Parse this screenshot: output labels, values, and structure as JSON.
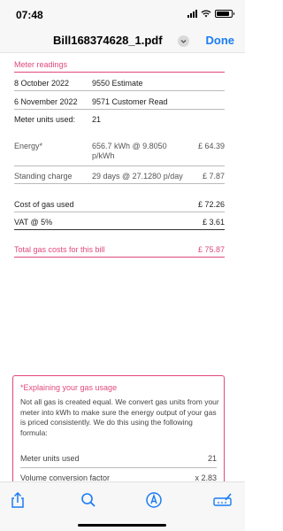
{
  "status_bar": {
    "time": "07:48",
    "battery_level": 0.9
  },
  "nav": {
    "title": "Bill168374628_1.pdf",
    "done_label": "Done"
  },
  "meter": {
    "heading": "Meter readings",
    "rows": [
      {
        "date": "8 October 2022",
        "reading": "9550 Estimate"
      },
      {
        "date": "6 November 2022",
        "reading": "9571 Customer Read"
      }
    ],
    "units_label": "Meter units used:",
    "units_value": "21"
  },
  "charges": {
    "energy": {
      "label": "Energy*",
      "detail_line1": "656.7 kWh @ 9.8050",
      "detail_line2": "p/kWh",
      "amount": "£ 64.39"
    },
    "standing": {
      "label": "Standing charge",
      "detail": "29 days @ 27.1280 p/day",
      "amount": "£ 7.87"
    }
  },
  "totals": {
    "cost_label": "Cost of gas used",
    "cost_value": "£ 72.26",
    "vat_label": "VAT @ 5%",
    "vat_value": "£ 3.61",
    "total_label": "Total gas costs for this bill",
    "total_value": "£ 75.87"
  },
  "explain": {
    "title": "*Explaining your gas usage",
    "paragraph": "Not all gas is created equal. We convert gas units from your meter into kWh to make sure the energy output of your gas is priced consistently. We do this using the following formula:",
    "rows": [
      {
        "label": "Meter units used",
        "value": "21"
      },
      {
        "label": "Volume conversion factor",
        "value": "x 2.83"
      }
    ]
  },
  "toolbar": {
    "icons": [
      "share-icon",
      "search-icon",
      "markup-icon",
      "signature-icon"
    ],
    "accent": "#1a7cf5"
  },
  "colors": {
    "accent_pink": "#e0497a",
    "link_blue": "#1a7cf5"
  }
}
